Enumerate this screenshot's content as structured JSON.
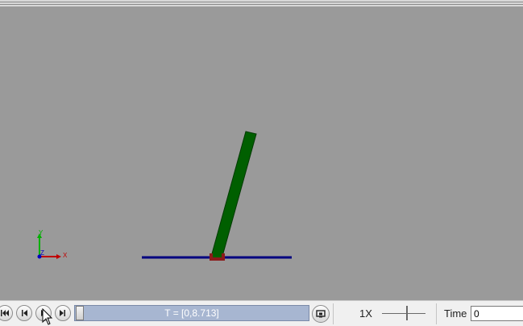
{
  "viewport": {
    "colors": {
      "background": "#9a9a9a",
      "ground": "#00007f",
      "pendulum": "#005f00",
      "pivot": "#8b1a1a",
      "axis_x": "#c00000",
      "axis_y": "#00b000",
      "axis_z": "#0000c0"
    },
    "axes": {
      "x_label": "X",
      "y_label": "Y",
      "z_label": "Z"
    }
  },
  "controls": {
    "buttons": [
      {
        "name": "skip-to-start-button",
        "icon": "skip-back-icon"
      },
      {
        "name": "step-back-button",
        "icon": "step-back-icon"
      },
      {
        "name": "play-button",
        "icon": "play-icon"
      },
      {
        "name": "step-forward-button",
        "icon": "step-forward-icon"
      }
    ],
    "slider_label": "T = [0,8.713]",
    "speed_label": "1X",
    "time_label": "Time",
    "time_value": "0"
  }
}
